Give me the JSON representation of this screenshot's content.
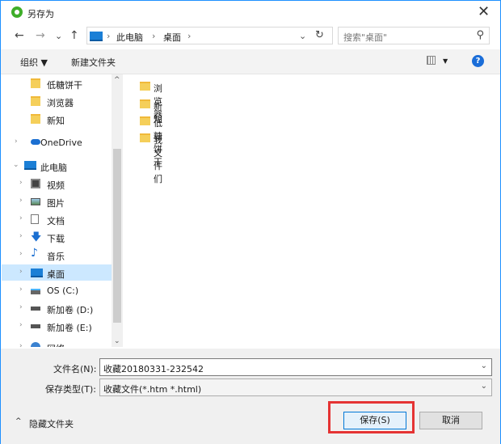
{
  "window": {
    "title": "另存为",
    "close": "✕"
  },
  "nav": {
    "back": "←",
    "forward": "→",
    "recent": "⌄",
    "up": "↑"
  },
  "address": {
    "crumbs": [
      "此电脑",
      "桌面"
    ],
    "sep": "›",
    "dropdown": "⌄",
    "refresh": "↻"
  },
  "search": {
    "placeholder": "搜索\"桌面\"",
    "icon": "⚲"
  },
  "toolbar": {
    "organize": "组织 ▼",
    "new_folder": "新建文件夹",
    "view_arrow": "▼",
    "help": "?"
  },
  "nav_pane": {
    "items": [
      {
        "label": "低糖饼干",
        "icon": "folder-icon"
      },
      {
        "label": "浏览器",
        "icon": "folder-icon"
      },
      {
        "label": "新知",
        "icon": "folder-icon"
      },
      {
        "label": "OneDrive",
        "icon": "cloud-icon",
        "chevron": "›"
      },
      {
        "label": "此电脑",
        "icon": "computer-icon",
        "chevron": "⌄"
      },
      {
        "label": "视频",
        "icon": "video-icon",
        "chevron": "›"
      },
      {
        "label": "图片",
        "icon": "picture-icon",
        "chevron": "›"
      },
      {
        "label": "文档",
        "icon": "document-icon",
        "chevron": "›"
      },
      {
        "label": "下载",
        "icon": "download-icon",
        "chevron": "›"
      },
      {
        "label": "音乐",
        "icon": "music-icon",
        "chevron": "›"
      },
      {
        "label": "桌面",
        "icon": "desktop-icon",
        "chevron": "›",
        "selected": true
      },
      {
        "label": "OS (C:)",
        "icon": "drive-icon",
        "chevron": "›"
      },
      {
        "label": "新加卷 (D:)",
        "icon": "drive-icon",
        "chevron": "›"
      },
      {
        "label": "新加卷 (E:)",
        "icon": "drive-icon",
        "chevron": "›"
      },
      {
        "label": "网络",
        "icon": "network-icon",
        "chevron": "›"
      }
    ],
    "scroll_up": "^",
    "scroll_down": "⌄"
  },
  "files": [
    "浏览器",
    "新知",
    "低糖饼干",
    "我文件们"
  ],
  "form": {
    "filename_label": "文件名(N):",
    "filename_value": "收藏20180331-232542",
    "filetype_label": "保存类型(T):",
    "filetype_value": "收藏文件(*.htm *.html)",
    "dropdown_arrow": "⌄"
  },
  "footer": {
    "hide_folders": "隐藏文件夹",
    "hide_chevron": "^",
    "save": "保存(S)",
    "cancel": "取消"
  },
  "colors": {
    "selection": "#cce8ff",
    "highlight": "#e53333",
    "accent": "#0078d7"
  }
}
